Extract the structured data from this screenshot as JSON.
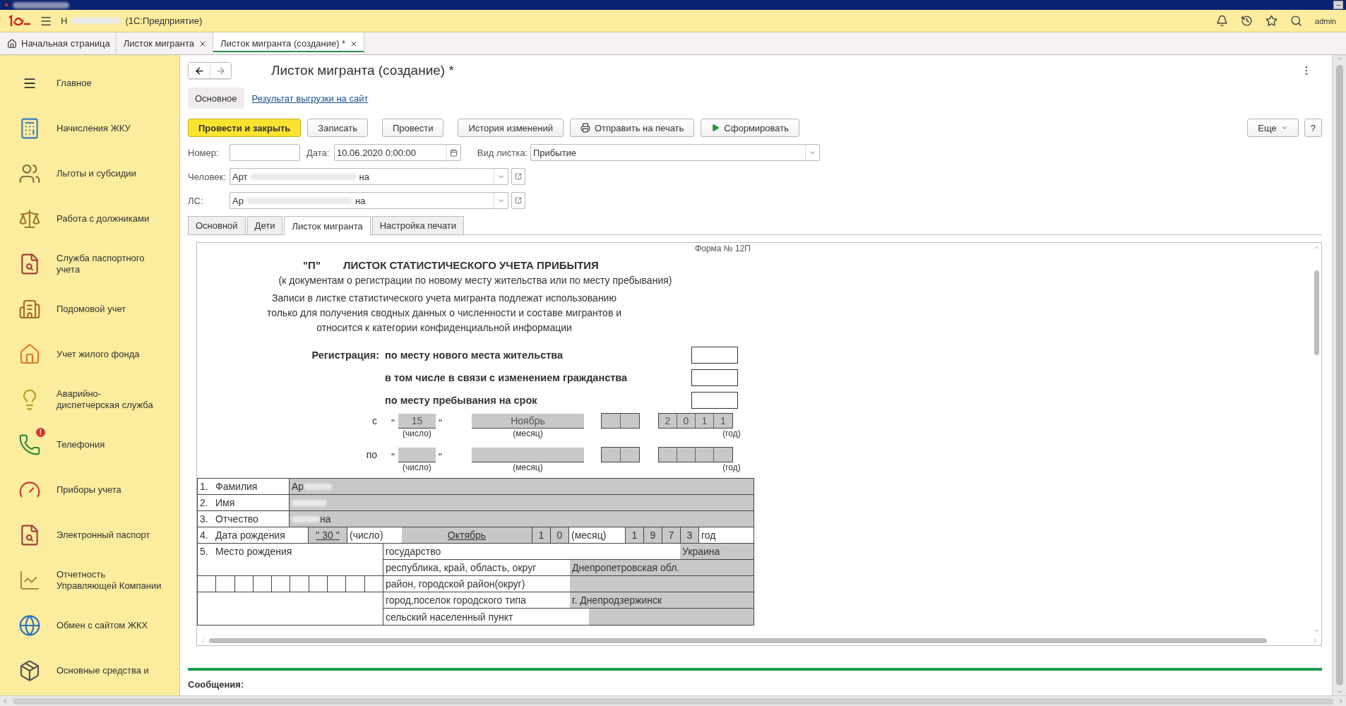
{
  "app": {
    "name_start": "Н",
    "product": "(1С:Предприятие)",
    "user": "admin"
  },
  "tabs": [
    {
      "label": "Начальная страница",
      "kind": "home",
      "selected": false
    },
    {
      "label": "Листок мигранта",
      "kind": "closable",
      "selected": false
    },
    {
      "label": "Листок мигранта (создание) *",
      "kind": "closable",
      "selected": true
    }
  ],
  "sidebar": {
    "items": [
      {
        "label": "Главное"
      },
      {
        "label": "Начисления ЖКУ"
      },
      {
        "label": "Льготы и субсидии"
      },
      {
        "label": "Работа с должниками"
      },
      {
        "label": "Служба паспортного учета"
      },
      {
        "label": "Подомовой учет"
      },
      {
        "label": "Учет жилого фонда"
      },
      {
        "label": "Аварийно-диспетчерская служба"
      },
      {
        "label": "Телефония",
        "badge": "!"
      },
      {
        "label": "Приборы учета"
      },
      {
        "label": "Электронный паспорт"
      },
      {
        "label": "Отчетность Управляющей Компании"
      },
      {
        "label": "Обмен с сайтом ЖКХ"
      },
      {
        "label": "Основные средства и"
      }
    ]
  },
  "form": {
    "title": "Листок мигранта (создание) *",
    "sections": [
      {
        "label": "Основное",
        "selected": true
      },
      {
        "label": "Результат выгрузки на сайт",
        "selected": false
      }
    ],
    "buttons": [
      {
        "label": "Провести и закрыть",
        "kind": "primary"
      },
      {
        "label": "Записать",
        "kind": "plain"
      },
      {
        "label": "Провести",
        "kind": "plain"
      },
      {
        "label": "История изменений",
        "kind": "plain"
      },
      {
        "label": "Отправить на печать",
        "kind": "print"
      },
      {
        "label": "Сформировать",
        "kind": "run"
      }
    ],
    "more_button": "Еще",
    "help_button": "?",
    "number": {
      "label": "Номер:"
    },
    "date": {
      "label": "Дата:",
      "value": "10.06.2020  0:00:00"
    },
    "sheet_type": {
      "label": "Вид листка:",
      "value": "Прибытие"
    },
    "person": {
      "label": "Человек:",
      "value_start": "Арт",
      "value_end": "на"
    },
    "account": {
      "label": "ЛС:",
      "value_start": "Ар",
      "value_end": "на"
    },
    "inner_tabs": [
      {
        "label": "Основной",
        "selected": false
      },
      {
        "label": "Дети",
        "selected": false
      },
      {
        "label": "Листок мигранта",
        "selected": true
      },
      {
        "label": "Настройка печати",
        "selected": false
      }
    ]
  },
  "document": {
    "form_number": "Форма № 12П",
    "mark": "\"П\"",
    "title": "ЛИСТОК СТАТИСТИЧЕСКОГО УЧЕТА ПРИБЫТИЯ",
    "subtitle": "(к документам о регистрации по новому месту жительства или по месту пребывания)",
    "notice": [
      "Записи в листке статистического учета мигранта подлежат использованию",
      "только для получения сводных данных о численности и составе мигрантов и",
      "относится к категории конфиденциальной информации"
    ],
    "registration": {
      "label": "Регистрация:",
      "options": [
        {
          "label": "по месту нового места жительства",
          "checked": false
        },
        {
          "label": "в том числе в связи с изменением гражданства",
          "checked": false
        },
        {
          "label": "по месту пребывания на срок",
          "checked": false
        }
      ]
    },
    "periods": [
      {
        "prefix": "с",
        "open_quote": "\"",
        "day": "15",
        "close_quote": "\"",
        "month": "Ноябрь",
        "year_digits": [
          "2",
          "0",
          "1",
          "1"
        ],
        "day_caption": "(число)",
        "month_caption": "(месяц)",
        "year_caption": "(год)"
      },
      {
        "prefix": "по",
        "open_quote": "\"",
        "close_quote": "\"",
        "day_caption": "(число)",
        "month_caption": "(месяц)",
        "year_caption": "(год)"
      }
    ],
    "name_rows": [
      {
        "number": "1.",
        "label": "Фамилия",
        "value": "Ар"
      },
      {
        "number": "2.",
        "label": "Имя"
      },
      {
        "number": "3.",
        "label": "Отчество",
        "value": "на"
      }
    ],
    "birth_date": {
      "number": "4.",
      "label": "Дата рождения",
      "day": "\" 30 \"",
      "day_caption": "(число)",
      "month": "Октябрь",
      "month_digits": [
        "1",
        "0"
      ],
      "month_caption": "(месяц)",
      "year_digits": [
        "1",
        "9",
        "7",
        "3"
      ],
      "year_caption": "год"
    },
    "birth_place": {
      "number": "5.",
      "label": "Место рождения",
      "rows": [
        {
          "label": "государство",
          "value": "Украина",
          "kind": "short"
        },
        {
          "label": "республика, край, область, округ",
          "value": "Днепропетровская обл.",
          "kind": "long"
        },
        {
          "label": "район, городской район(округ)",
          "kind": "long"
        },
        {
          "label": "город,поселок городского типа",
          "value": "г. Днепродзержинск",
          "kind": "long"
        },
        {
          "label": "сельский населенный пункт",
          "kind": "medium"
        }
      ]
    }
  },
  "messages_label": "Сообщения:"
}
